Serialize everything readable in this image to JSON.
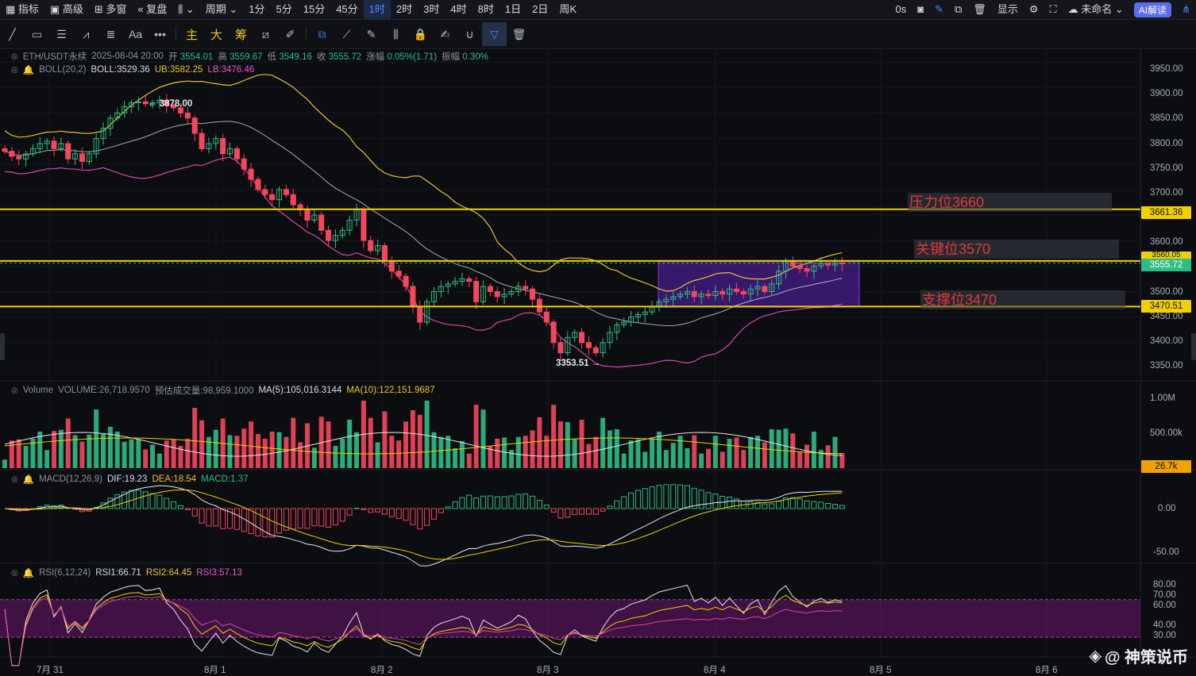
{
  "topbar": {
    "left": [
      "指标",
      "高级",
      "多窗",
      "复盘",
      "周期"
    ],
    "timeframes": [
      "1分",
      "5分",
      "15分",
      "45分",
      "1时",
      "2时",
      "3时",
      "4时",
      "8时",
      "1日",
      "2日",
      "周K"
    ],
    "active_timeframe": "1时",
    "countdown": "0s",
    "display_label": "显示",
    "layout_name": "未命名",
    "ai_label": "AI解读"
  },
  "toolbar": {
    "main_label": "主",
    "big_label": "大",
    "chips_label": "筹",
    "text_tool": "Aa",
    "more": "•••"
  },
  "main_info": {
    "symbol": "ETH/USDT永续",
    "datetime": "2025-08-04 20:00",
    "open_label": "开",
    "open": "3554.01",
    "high_label": "高",
    "high": "3559.67",
    "low_label": "低",
    "low": "3549.16",
    "close_label": "收",
    "close": "3555.72",
    "change_label": "涨幅",
    "change": "0.05%(1.71)",
    "amplitude_label": "振幅",
    "amplitude": "0.30%"
  },
  "boll_info": {
    "name": "BOLL(20,2)",
    "boll": "BOLL:3529.36",
    "ub": "UB:3582.25",
    "lb": "LB:3476.46"
  },
  "volume_info": {
    "name": "Volume",
    "volume": "VOLUME:26,718.9570",
    "est": "预估成交量:98,959.1000",
    "ma5": "MA(5):105,016.3144",
    "ma10": "MA(10):122,151.9687"
  },
  "macd_info": {
    "name": "MACD(12,26,9)",
    "dif": "DIF:19.23",
    "dea": "DEA:18.54",
    "macd": "MACD:1.37"
  },
  "rsi_info": {
    "name": "RSI(6,12,24)",
    "rsi1": "RSI1:66.71",
    "rsi2": "RSI2:64.45",
    "rsi3": "RSI3:57.13"
  },
  "price_axis": [
    "3950.00",
    "3900.00",
    "3850.00",
    "3800.00",
    "3750.00",
    "3700.00",
    "3650.00",
    "3600.00",
    "3550.00",
    "3500.00",
    "3450.00",
    "3400.00",
    "3350.00"
  ],
  "price_tags": {
    "resistance": "3661.36",
    "key_hidden": "3560.05",
    "current": "3555.72",
    "support": "3470.51"
  },
  "volume_axis": [
    "1.00M",
    "500.00k"
  ],
  "volume_tag": "26.7k",
  "macd_axis": [
    "0.00",
    "-50.00"
  ],
  "rsi_axis": [
    "80.00",
    "70.00",
    "60.00",
    "40.00",
    "30.00"
  ],
  "x_axis": [
    "7月 31",
    "8月 1",
    "8月 2",
    "8月 3",
    "8月 4",
    "8月 5",
    "8月 6"
  ],
  "annotations": {
    "resistance": "压力位3660",
    "key": "关键位3570",
    "support": "支撑位3470",
    "high_mark": "3878.00",
    "low_mark": "3353.51"
  },
  "watermark": "@ 神策说币",
  "colors": {
    "up": "#2ebd85",
    "down": "#f6465d",
    "line": "#f0d000",
    "ub": "#e8c23a",
    "mid": "#cfd3d9",
    "lb": "#d946a8",
    "box": "#6d28d9"
  },
  "chart_data": {
    "type": "candlestick",
    "title": "ETH/USDT永续 1H",
    "xlabel": "",
    "ylabel": "",
    "ylim": [
      3325,
      3975
    ],
    "horizontal_levels": [
      3661.36,
      3560.05,
      3470.51
    ],
    "closes": [
      3775,
      3765,
      3760,
      3770,
      3780,
      3790,
      3795,
      3780,
      3790,
      3760,
      3770,
      3755,
      3770,
      3800,
      3820,
      3840,
      3850,
      3862,
      3870,
      3872,
      3868,
      3870,
      3875,
      3865,
      3860,
      3850,
      3840,
      3810,
      3780,
      3790,
      3800,
      3770,
      3780,
      3760,
      3740,
      3720,
      3700,
      3690,
      3680,
      3700,
      3690,
      3670,
      3660,
      3640,
      3650,
      3620,
      3600,
      3610,
      3620,
      3640,
      3660,
      3600,
      3580,
      3590,
      3560,
      3540,
      3530,
      3510,
      3470,
      3440,
      3480,
      3500,
      3510,
      3515,
      3520,
      3525,
      3520,
      3480,
      3510,
      3500,
      3490,
      3495,
      3500,
      3510,
      3505,
      3485,
      3460,
      3440,
      3400,
      3380,
      3410,
      3420,
      3400,
      3390,
      3380,
      3400,
      3420,
      3435,
      3440,
      3450,
      3455,
      3460,
      3470,
      3480,
      3485,
      3490,
      3495,
      3500,
      3490,
      3495,
      3492,
      3500,
      3495,
      3505,
      3500,
      3495,
      3505,
      3510,
      3500,
      3515,
      3540,
      3560,
      3550,
      3545,
      3540,
      3550,
      3555,
      3552,
      3556,
      3555
    ]
  }
}
